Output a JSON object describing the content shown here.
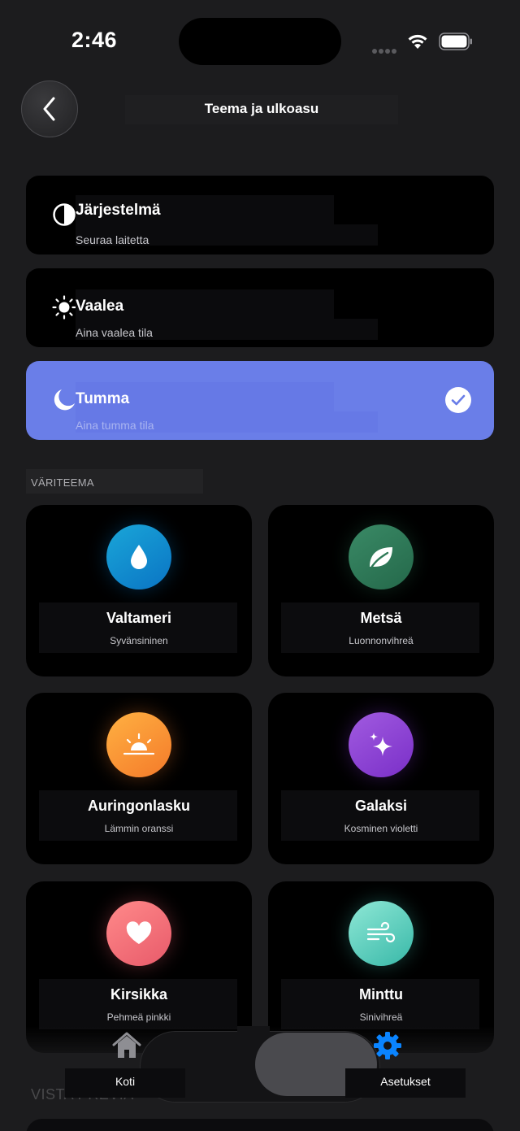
{
  "status": {
    "time": "2:46"
  },
  "nav": {
    "title": "Teema ja ulkoasu"
  },
  "modes": [
    {
      "title": "Järjestelmä",
      "subtitle": "Seuraa laitetta",
      "icon": "half-circle-icon",
      "selected": false
    },
    {
      "title": "Vaalea",
      "subtitle": "Aina vaalea tila",
      "icon": "sun-icon",
      "selected": false
    },
    {
      "title": "Tumma",
      "subtitle": "Aina tumma tila",
      "icon": "moon-icon",
      "selected": true
    }
  ],
  "section": {
    "color_theme_label": "VÄRITEEMA"
  },
  "themes": [
    {
      "name": "Valtameri",
      "subtitle": "Syvänsininen",
      "icon": "drop-icon",
      "color_from": "#1aa6d8",
      "color_to": "#0a74c4"
    },
    {
      "name": "Metsä",
      "subtitle": "Luonnonvihreä",
      "icon": "leaf-icon",
      "color_from": "#3a8a66",
      "color_to": "#24684a"
    },
    {
      "name": "Auringonlasku",
      "subtitle": "Lämmin oranssi",
      "icon": "sunset-icon",
      "color_from": "#ffb142",
      "color_to": "#f47a2a"
    },
    {
      "name": "Galaksi",
      "subtitle": "Kosminen violetti",
      "icon": "sparkles-icon",
      "color_from": "#a15be0",
      "color_to": "#7a2fc8"
    },
    {
      "name": "Kirsikka",
      "subtitle": "Pehmeä pinkki",
      "icon": "heart-icon",
      "color_from": "#ff8a8a",
      "color_to": "#e85a6a"
    },
    {
      "name": "Minttu",
      "subtitle": "Sinivihreä",
      "icon": "wind-icon",
      "color_from": "#8fe8d6",
      "color_to": "#38b8a8"
    }
  ],
  "preview": {
    "label": "VISTA PREVIA"
  },
  "tabs": [
    {
      "label": "Koti",
      "icon": "house-icon",
      "active": false
    },
    {
      "label": "Asetukset",
      "icon": "gear-icon",
      "active": true
    }
  ],
  "colors": {
    "accent": "#6a7ee8",
    "tab_active": "#0a84ff"
  }
}
